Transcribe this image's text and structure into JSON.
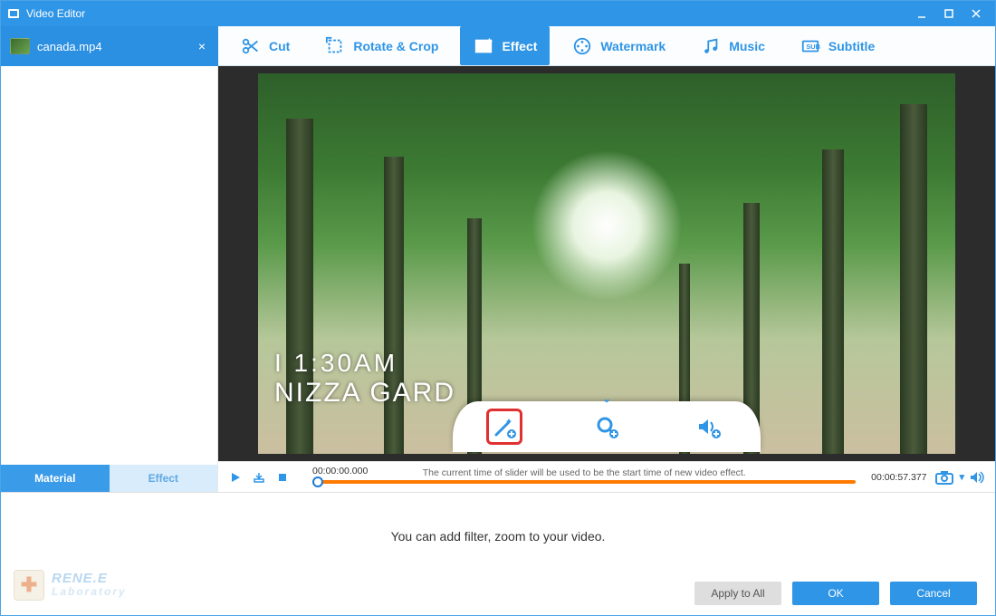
{
  "window": {
    "title": "Video Editor"
  },
  "file_tab": {
    "name": "canada.mp4"
  },
  "toolbar": {
    "items": [
      {
        "label": "Cut"
      },
      {
        "label": "Rotate & Crop"
      },
      {
        "label": "Effect"
      },
      {
        "label": "Watermark"
      },
      {
        "label": "Music"
      },
      {
        "label": "Subtitle"
      }
    ],
    "active_index": 2
  },
  "sidebar_tabs": {
    "material": "Material",
    "effect": "Effect",
    "active": "material"
  },
  "preview_overlay": {
    "line1": "I 1:30AM",
    "line2": "NIZZA GARD"
  },
  "effect_pill": {
    "wand": "add-filter",
    "zoom": "add-zoom",
    "volume": "add-volume"
  },
  "timeline": {
    "start": "00:00:00.000",
    "end": "00:00:57.377",
    "hint": "The current time of slider will be used to be the start time of new video effect."
  },
  "lower": {
    "hint": "You can add filter, zoom to your video.",
    "apply_all": "Apply to All",
    "ok": "OK",
    "cancel": "Cancel"
  },
  "brand": {
    "line1": "RENE.E",
    "line2": "Laboratory"
  }
}
